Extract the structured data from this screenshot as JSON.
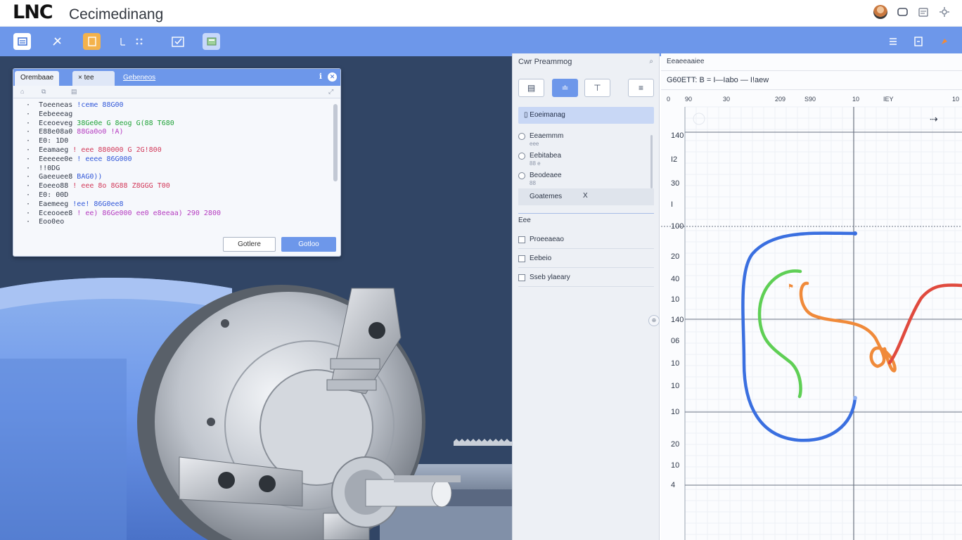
{
  "header": {
    "logo": "LNC",
    "app_title": "Cecimedinang",
    "icons": [
      "avatar",
      "message-icon",
      "doc-icon",
      "settings-icon"
    ]
  },
  "toolbar": {
    "icons": [
      "list-icon",
      "cut-icon",
      "file-icon",
      "grid-icon",
      "check-icon",
      "image-icon"
    ],
    "right_icons": [
      "save-icon",
      "export-icon",
      "pin-icon"
    ],
    "accent": "#6d97ea"
  },
  "code_dialog": {
    "tabs": [
      "Orembaae",
      "tee",
      "Gebeneos"
    ],
    "cancel_label": "Gotlere",
    "ok_label": "Gotloo",
    "lines": [
      {
        "prefix": "·",
        "code": "Toeeneas",
        "val": "!ceme 88G00",
        "color": "b"
      },
      {
        "prefix": "·",
        "code": "Eebeeeag",
        "val": "",
        "color": "b"
      },
      {
        "prefix": "·",
        "code": "Eceoeveg",
        "val": "38Ge0e G 8eog G(88 T680",
        "color": "g"
      },
      {
        "prefix": "·",
        "code": "E88e08a0",
        "val": "88Ga0o0 !A)",
        "color": "m"
      },
      {
        "prefix": "·",
        "code": "E0: 1D0",
        "val": "",
        "color": "b"
      },
      {
        "prefix": "·",
        "code": "Eeamaeg",
        "val": "! eee 880000 G 2G!800",
        "color": "r"
      },
      {
        "prefix": "·",
        "code": "Eeeeee0e",
        "val": "! eeee 86G000",
        "color": "b"
      },
      {
        "prefix": "·",
        "code": "!!0DG",
        "val": "",
        "color": "b"
      },
      {
        "prefix": "·",
        "code": "Gaeeuee8",
        "val": "BAG0))",
        "color": "b"
      },
      {
        "prefix": "·",
        "code": "Eoeeo88",
        "val": "! eee 8o 8G88 Z8GGG T00",
        "color": "r"
      },
      {
        "prefix": "·",
        "code": "E0: 00D",
        "val": "",
        "color": "b"
      },
      {
        "prefix": "·",
        "code": "Eaemeeg",
        "val": "!ee! 86G0ee8",
        "color": "b"
      },
      {
        "prefix": "·",
        "code": "Eceooee8",
        "val": "! ee) 86Ge000 ee0 e8eeaa) 290 2800",
        "color": "m"
      },
      {
        "prefix": "·",
        "code": "Eoo0eo",
        "val": "",
        "color": "b"
      }
    ]
  },
  "mid_panel": {
    "title": "Cwr Preammog",
    "selected_item": "Eoeimanag",
    "radios": [
      {
        "label": "Eeaemmm",
        "sub": "eee"
      },
      {
        "label": "Eebitabea",
        "sub": "88 e"
      },
      {
        "label": "Beodeaee",
        "sub": "88"
      }
    ],
    "chip_label": "Goatemes",
    "chip_close": "X",
    "section_label": "Eee",
    "checks": [
      {
        "label": "Proeeaeao"
      },
      {
        "label": "Eebeio"
      },
      {
        "label": "Sseb ylaeary"
      }
    ]
  },
  "plot_panel": {
    "title": "Eeaeeaaiee",
    "program_label": "G60ETT: B = I—Iabo — I!aew",
    "x_ticks": [
      "0",
      "90",
      "30",
      "209",
      "S90",
      "10",
      "IEY",
      "10"
    ],
    "y_ticks": [
      "140",
      "I2",
      "30",
      "I",
      "100",
      "20",
      "40",
      "10",
      "140",
      "06",
      "10",
      "10",
      "10",
      "20",
      "10",
      "4"
    ],
    "arrow_label": "⇢"
  },
  "chart_data": {
    "type": "line",
    "series": [
      {
        "color": "#3a6fe0"
      },
      {
        "color": "#5fcf55"
      },
      {
        "color": "#f08a3a"
      },
      {
        "color": "#e04a3e"
      }
    ]
  }
}
